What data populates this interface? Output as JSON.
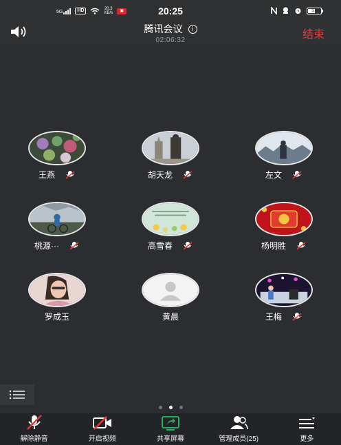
{
  "status_bar": {
    "network": "5G",
    "hd": "HD",
    "speed_top": "20.3",
    "speed_bottom": "KB/s",
    "time": "20:25",
    "battery": "51"
  },
  "header": {
    "title": "腾讯会议",
    "duration": "02:06:32",
    "end_label": "结束"
  },
  "participants": [
    {
      "name": "王燕",
      "avatar": "photo-flowers"
    },
    {
      "name": "胡天龙",
      "avatar": "photo-statue"
    },
    {
      "name": "左文",
      "avatar": "photo-scenery"
    },
    {
      "name": "桃源···",
      "avatar": "photo-cyclist"
    },
    {
      "name": "高雪春",
      "avatar": "photo-text-card"
    },
    {
      "name": "杨明胜",
      "avatar": "photo-red-card"
    },
    {
      "name": "罗成玉",
      "avatar": "photo-portrait"
    },
    {
      "name": "黄晨",
      "avatar": "default-avatar"
    },
    {
      "name": "王梅",
      "avatar": "photo-stage"
    }
  ],
  "pager": {
    "count": 3,
    "active": 1
  },
  "toolbar": {
    "unmute": "解除静音",
    "video": "开启视频",
    "share": "共享屏幕",
    "members": "管理成员(25)",
    "more": "更多"
  },
  "colors": {
    "background": "#2b2d30",
    "end": "#e63a3a",
    "share_green": "#22b35e",
    "mute_red": "#e53935"
  }
}
